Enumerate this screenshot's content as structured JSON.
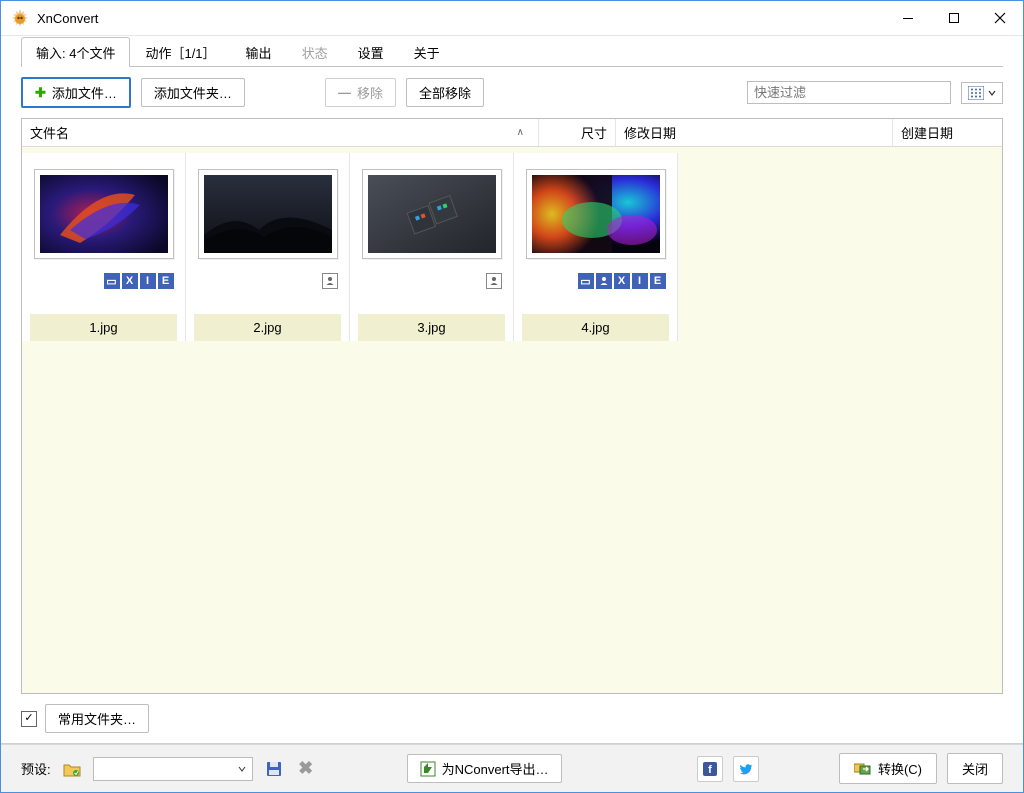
{
  "app": {
    "title": "XnConvert",
    "icon_color": "#e08a1a"
  },
  "tabs": {
    "input": "输入:  4个文件",
    "actions": "动作［1/1］",
    "output": "输出",
    "status": "状态",
    "settings": "设置",
    "about": "关于"
  },
  "toolbar": {
    "add_files": "添加文件…",
    "add_folder": "添加文件夹…",
    "remove": "移除",
    "remove_all": "全部移除",
    "quick_filter_placeholder": "快速过滤"
  },
  "columns": {
    "filename": "文件名",
    "size": "尺寸",
    "modified": "修改日期",
    "created": "创建日期"
  },
  "files": [
    {
      "name": "1.jpg",
      "thumb": "abstract-swirl",
      "badges": [
        "minus_blue",
        "X",
        "I",
        "E"
      ]
    },
    {
      "name": "2.jpg",
      "thumb": "mountain-night",
      "badges": [
        "person_gray"
      ]
    },
    {
      "name": "3.jpg",
      "thumb": "dark-cards",
      "badges": [
        "person_gray"
      ]
    },
    {
      "name": "4.jpg",
      "thumb": "nebula-color",
      "badges": [
        "minus_blue",
        "person_blue",
        "X",
        "I",
        "E"
      ]
    }
  ],
  "hotfolders": {
    "label": "常用文件夹…",
    "checked": true
  },
  "bottombar": {
    "preset_label": "预设:",
    "export_nconvert": "为NConvert导出…",
    "convert": "转换(C)",
    "close": "关闭"
  }
}
